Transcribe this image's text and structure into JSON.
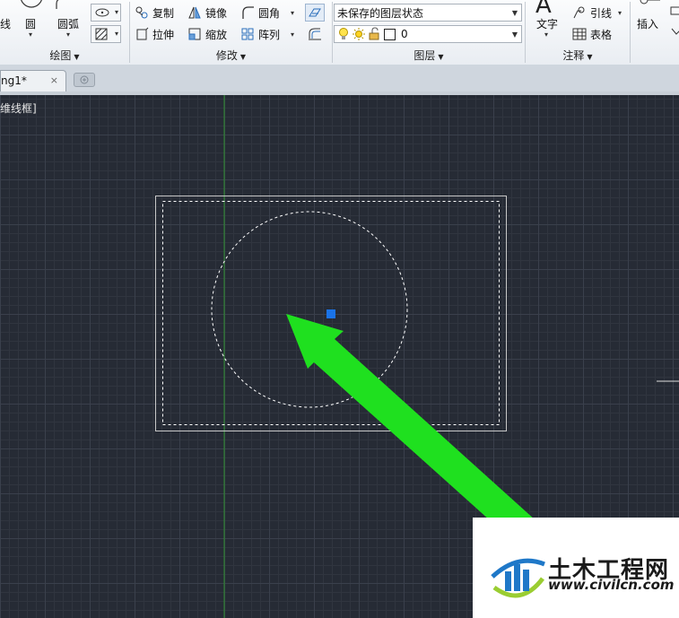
{
  "ribbon": {
    "draw_panel": {
      "title": "绘图",
      "line_label": "线",
      "circle_label": "圆",
      "arc_label": "圆弧"
    },
    "modify_panel": {
      "title": "修改",
      "copy_label": "复制",
      "mirror_label": "镜像",
      "fillet_label": "圆角",
      "stretch_label": "拉伸",
      "scale_label": "缩放",
      "array_label": "阵列"
    },
    "layer_panel": {
      "title": "图层",
      "state_value": "未保存的图层状态",
      "current_layer": "0"
    },
    "annotation_panel": {
      "title": "注释",
      "text_label": "文字",
      "leader_label": "引线",
      "table_label": "表格",
      "text_glyph": "A"
    },
    "block_panel": {
      "insert_label": "插入"
    }
  },
  "tabs": {
    "doc_tab": "ng1*",
    "close_glyph": "×"
  },
  "viewport": {
    "label": "维线框]"
  },
  "watermark": {
    "title": "土木工程网",
    "url": "www.civilcn.com"
  },
  "colors": {
    "arrow": "#1fe01f",
    "grip": "#1a73e8",
    "axis_y": "#2f8f2f"
  }
}
